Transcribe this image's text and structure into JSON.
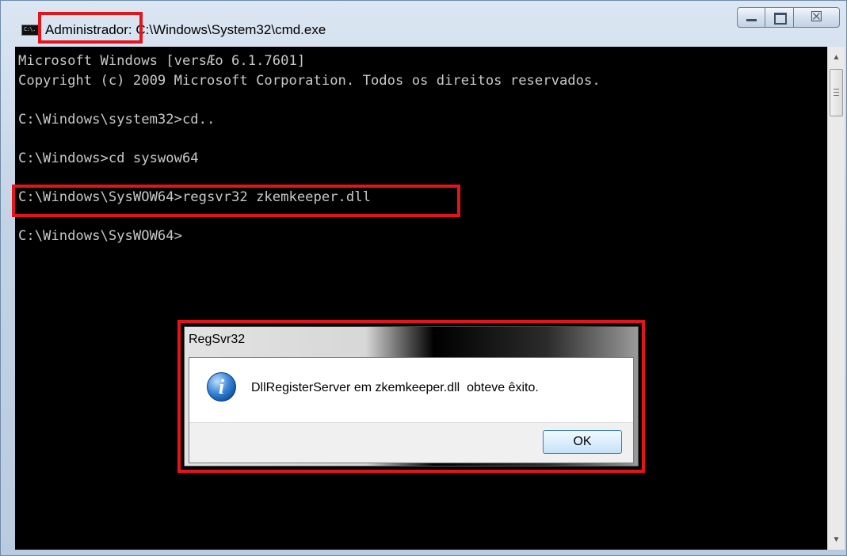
{
  "window": {
    "icon_glyph": "C:\\.",
    "title_admin": "Administrador:",
    "title_path": "C:\\Windows\\System32\\cmd.exe",
    "close_glyph": "☒"
  },
  "console": {
    "lines": [
      "Microsoft Windows [versÆo 6.1.7601]",
      "Copyright (c) 2009 Microsoft Corporation. Todos os direitos reservados.",
      "",
      "C:\\Windows\\system32>cd..",
      "",
      "C:\\Windows>cd syswow64",
      "",
      "C:\\Windows\\SysWOW64>regsvr32 zkemkeeper.dll",
      "",
      "C:\\Windows\\SysWOW64>"
    ]
  },
  "scrollbar": {
    "up_glyph": "▲",
    "down_glyph": "▼"
  },
  "dialog": {
    "title": "RegSvr32",
    "icon_glyph": "i",
    "message": "DllRegisterServer em zkemkeeper.dll  obteve êxito.",
    "ok_label": "OK"
  },
  "colors": {
    "highlight": "#e3141c",
    "console_bg": "#000000",
    "console_text": "#c8c8c8"
  },
  "icons": [
    "cmd-icon",
    "minimize-icon",
    "maximize-icon",
    "close-icon",
    "info-icon",
    "scroll-up-icon",
    "scroll-down-icon"
  ]
}
